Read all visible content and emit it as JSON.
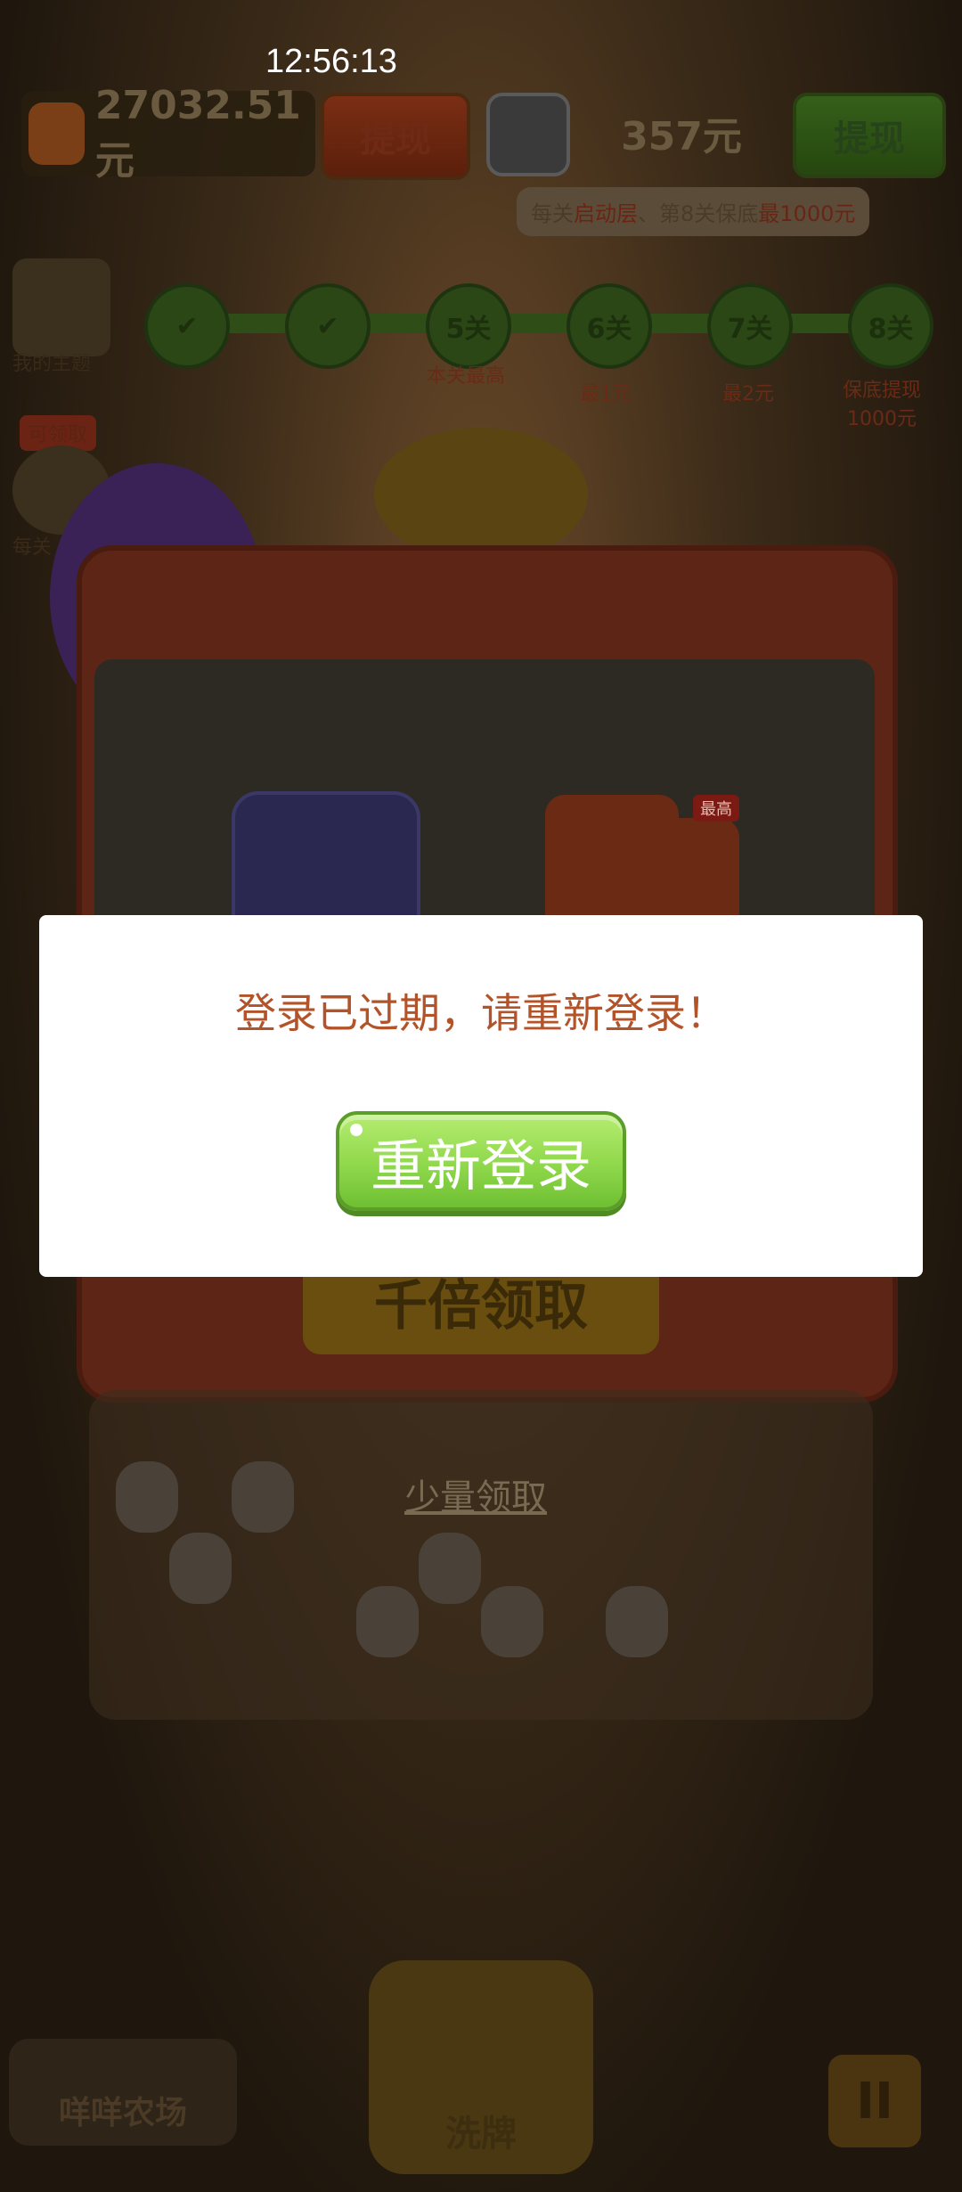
{
  "status_bar": {
    "time": "12:56:13"
  },
  "hud": {
    "cash_amount": "27032.51元",
    "withdraw_label_left": "提现",
    "friend_amount": "357元",
    "withdraw_label_right": "提现",
    "guarantee_note": {
      "prefix": "每关",
      "highlight1": "启动层",
      "middle": "、第8关保底",
      "highlight2": "最1000元"
    }
  },
  "side": {
    "my_theme": "我的主题",
    "claimable_badge": "可领取",
    "per_level": "每关"
  },
  "progress": {
    "steps": [
      "",
      "",
      "5关",
      "6关",
      "7关",
      "8关"
    ],
    "labels": [
      "",
      "",
      "本关最高",
      "最1元",
      "最2元",
      "保底提现1000元"
    ]
  },
  "reward_panel": {
    "max_badge": "最高",
    "bonus_button": "千倍领取",
    "small_claim": "少量领取"
  },
  "bottom_bar": {
    "farm": "咩咩农场",
    "shuffle": "洗牌",
    "pause": "II"
  },
  "dialog": {
    "message": "登录已过期，请重新登录！",
    "relogin_button": "重新登录"
  },
  "colors": {
    "dialog_text": "#b3532a",
    "button_green": "#8fd84b",
    "overlay": "#1f170d"
  }
}
